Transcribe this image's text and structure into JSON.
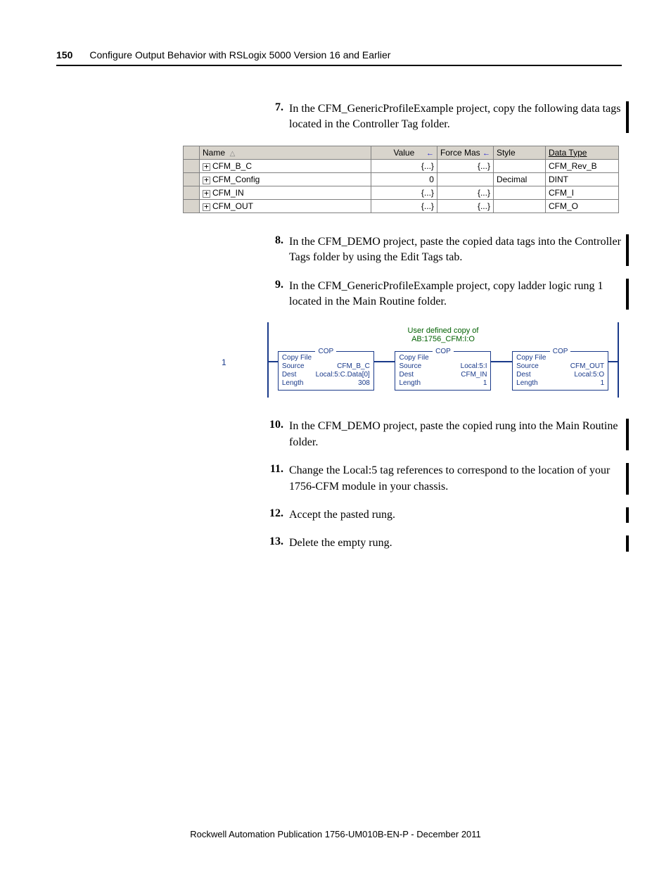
{
  "header": {
    "page_number": "150",
    "title": "Configure Output Behavior with RSLogix 5000 Version 16 and Earlier"
  },
  "steps": {
    "s7": {
      "num": "7.",
      "text": "In the CFM_GenericProfileExample project, copy the following data tags located in the Controller Tag folder."
    },
    "s8": {
      "num": "8.",
      "text": "In the CFM_DEMO project, paste the copied data tags into the Controller Tags folder by using the Edit Tags tab."
    },
    "s9": {
      "num": "9.",
      "text": "In the CFM_GenericProfileExample project, copy ladder logic rung 1 located in the Main Routine folder."
    },
    "s10": {
      "num": "10.",
      "text": "In the CFM_DEMO project, paste the copied rung into the Main Routine folder."
    },
    "s11": {
      "num": "11.",
      "text": "Change the Local:5 tag references to correspond to the location of your 1756-CFM module in your chassis."
    },
    "s12": {
      "num": "12.",
      "text": "Accept the pasted rung."
    },
    "s13": {
      "num": "13.",
      "text": "Delete the empty rung."
    }
  },
  "tag_table": {
    "headers": {
      "name": "Name",
      "value": "Value",
      "force": "Force Mas",
      "style": "Style",
      "type": "Data Type"
    },
    "rows": [
      {
        "name": "CFM_B_C",
        "value": "{...}",
        "force": "{...}",
        "style": "",
        "type": "CFM_Rev_B"
      },
      {
        "name": "CFM_Config",
        "value": "0",
        "force": "",
        "style": "Decimal",
        "type": "DINT"
      },
      {
        "name": "CFM_IN",
        "value": "{...}",
        "force": "{...}",
        "style": "",
        "type": "CFM_I"
      },
      {
        "name": "CFM_OUT",
        "value": "{...}",
        "force": "{...}",
        "style": "",
        "type": "CFM_O"
      }
    ]
  },
  "ladder": {
    "rung_num": "1",
    "comment_line1": "User defined copy of",
    "comment_line2": "AB:1756_CFM:I:O",
    "blocks": [
      {
        "title": "COP",
        "name": "Copy File",
        "source": "CFM_B_C",
        "dest": "Local:5:C.Data[0]",
        "length": "308"
      },
      {
        "title": "COP",
        "name": "Copy File",
        "source": "Local:5:I",
        "dest": "CFM_IN",
        "length": "1"
      },
      {
        "title": "COP",
        "name": "Copy File",
        "source": "CFM_OUT",
        "dest": "Local:5:O",
        "length": "1"
      }
    ]
  },
  "footer": "Rockwell Automation Publication 1756-UM010B-EN-P - December 2011"
}
